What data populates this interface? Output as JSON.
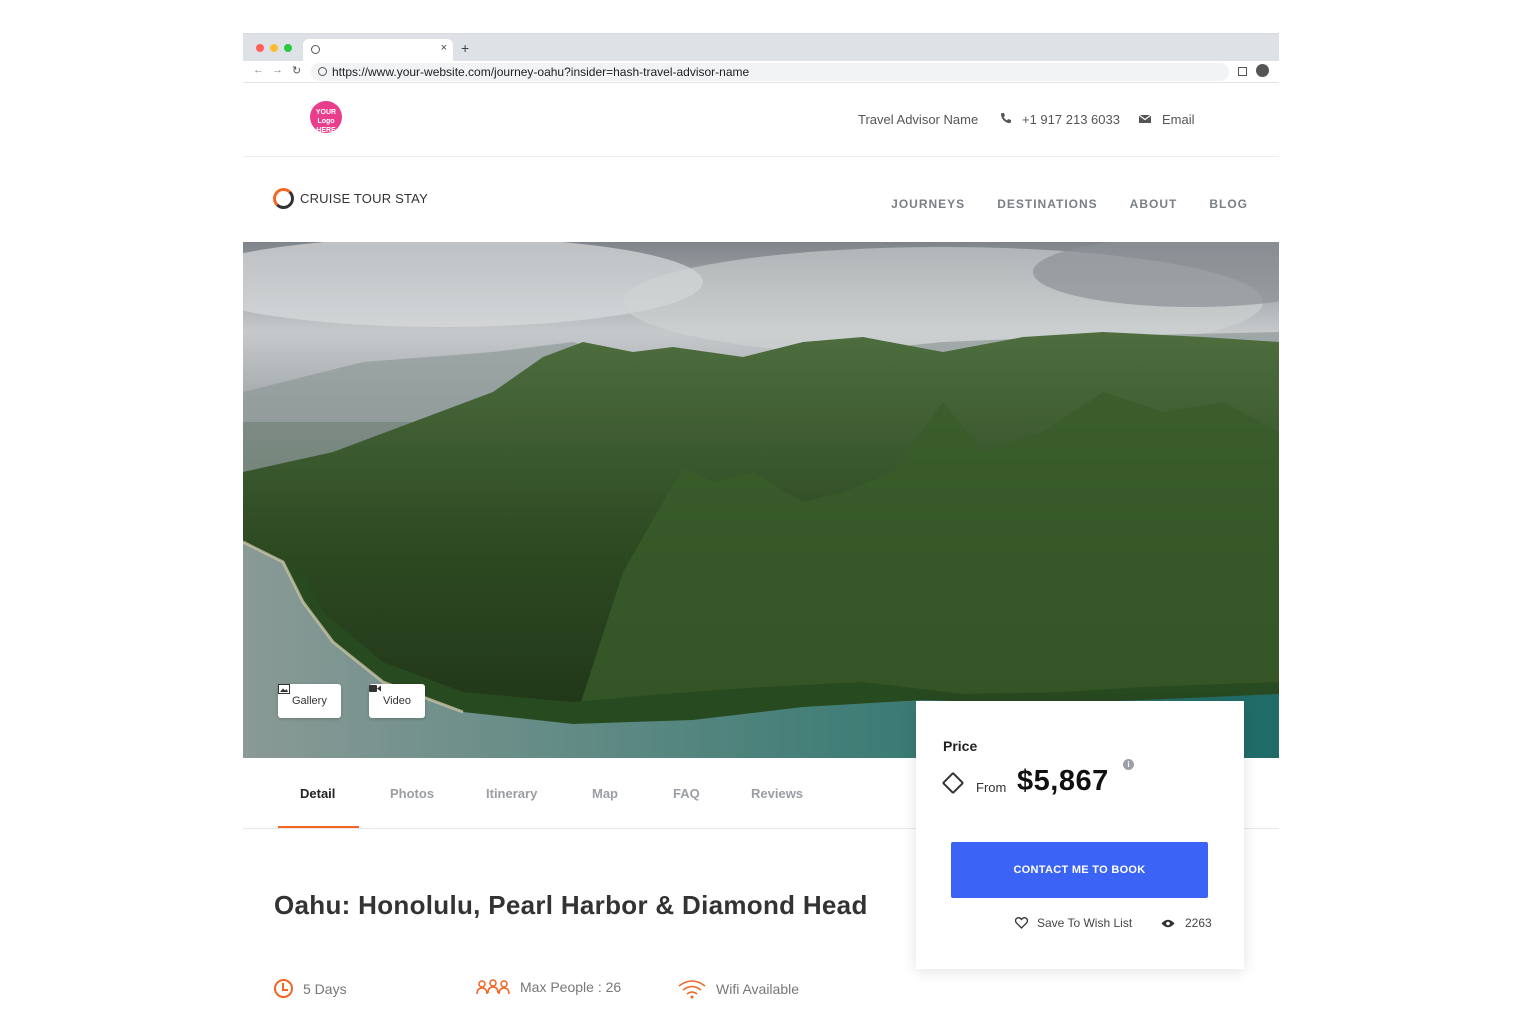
{
  "browser": {
    "url": "https://www.your-website.com/journey-oahu?insider=hash-travel-advisor-name",
    "new_tab": "+",
    "close_tab": "×"
  },
  "topbar": {
    "logo_lines": [
      "YOUR",
      "Logo",
      "HERE"
    ],
    "advisor_name": "Travel Advisor Name",
    "phone": "+1 917 213 6033",
    "email": "Email"
  },
  "brand": {
    "name_part1": "CRUISE",
    "name_part2": " TOUR STAY"
  },
  "nav": {
    "items": [
      "JOURNEYS",
      "DESTINATIONS",
      "ABOUT",
      "BLOG"
    ]
  },
  "hero": {
    "gallery_label": "Gallery",
    "video_label": "Video"
  },
  "tabs": {
    "items": [
      "Detail",
      "Photos",
      "Itinerary",
      "Map",
      "FAQ",
      "Reviews"
    ],
    "active": "Detail"
  },
  "journey": {
    "title": "Oahu: Honolulu, Pearl Harbor & Diamond Head",
    "duration": "5 Days",
    "max_people": "Max People : 26",
    "wifi": "Wifi Available"
  },
  "price": {
    "label": "Price",
    "from": "From",
    "amount": "$5,867",
    "cta": "CONTACT ME TO BOOK",
    "wishlist": "Save To Wish List",
    "views": "2263"
  },
  "colors": {
    "accent": "#f26522",
    "button": "#3b63f5",
    "logo_pink": "#e83e8c"
  }
}
